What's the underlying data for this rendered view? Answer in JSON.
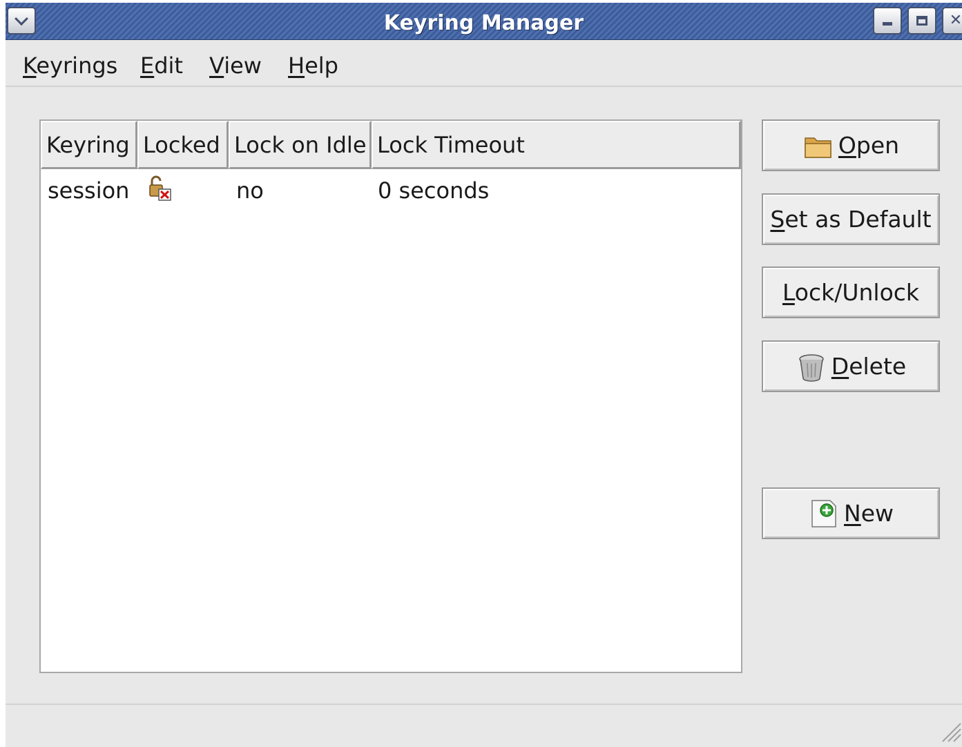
{
  "window": {
    "title": "Keyring Manager"
  },
  "menubar": {
    "items": [
      {
        "mnemonic": "K",
        "rest": "eyrings"
      },
      {
        "mnemonic": "E",
        "rest": "dit"
      },
      {
        "mnemonic": "V",
        "rest": "iew"
      },
      {
        "mnemonic": "H",
        "rest": "elp"
      }
    ]
  },
  "table": {
    "columns": [
      "Keyring",
      "Locked",
      "Lock on Idle",
      "Lock Timeout"
    ],
    "rows": [
      {
        "keyring": "session",
        "locked_icon": "unlocked-padlock-icon",
        "lock_on_idle": "no",
        "lock_timeout": "0 seconds"
      }
    ]
  },
  "buttons": {
    "open": {
      "icon": "folder-icon",
      "mnemonic": "O",
      "rest": "pen"
    },
    "set_default": {
      "mnemonic": "S",
      "rest": "et as Default"
    },
    "lock_unlock": {
      "mnemonic": "L",
      "rest": "ock/Unlock"
    },
    "delete": {
      "icon": "trash-can-icon",
      "mnemonic": "D",
      "rest": "elete"
    },
    "new": {
      "icon": "new-document-icon",
      "mnemonic": "N",
      "rest": "ew"
    }
  },
  "colors": {
    "titlebar": "#4f70b0",
    "window_bg": "#e8e8e8",
    "list_bg": "#ffffff"
  }
}
